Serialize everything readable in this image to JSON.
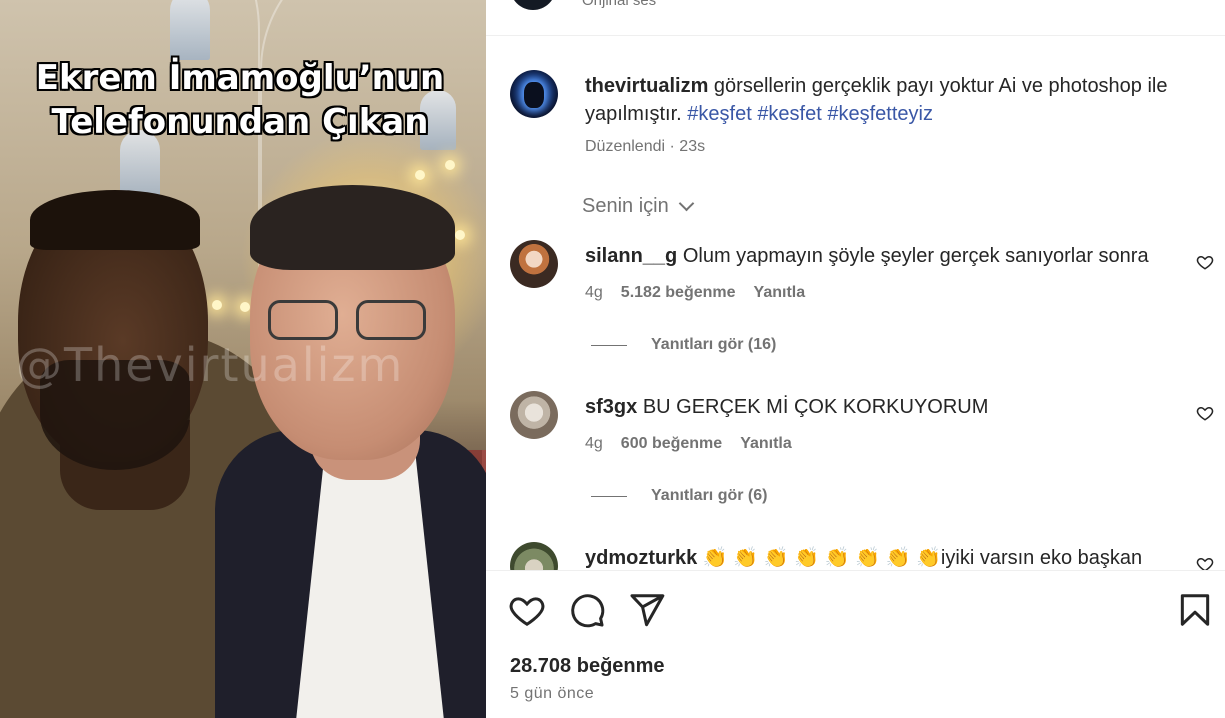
{
  "media": {
    "overlay_title_line1": "Ekrem İmamoğlu’nun",
    "overlay_title_line2": "Telefonundan Çıkan",
    "watermark": "@Thevirtualizm"
  },
  "header": {
    "audio_label": "Orijinal ses"
  },
  "caption": {
    "username": "thevirtualizm",
    "text": "görsellerin gerçeklik payı yoktur Ai ve photoshop ile yapılmıştır.",
    "hashtags": [
      "#keşfet",
      "#kesfet",
      "#keşfetteyiz"
    ],
    "edited_label": "Düzenlendi",
    "separator": "·",
    "age": "23s"
  },
  "sort": {
    "label": "Senin için"
  },
  "comments": [
    {
      "username": "silann__g",
      "text": "Olum yapmayın şöyle şeyler gerçek sanıyorlar sonra",
      "age": "4g",
      "likes": "5.182 beğenme",
      "reply_label": "Yanıtla",
      "view_replies": "Yanıtları gör (16)"
    },
    {
      "username": "sf3gx",
      "text": "BU GERÇEK Mİ ÇOK KORKUYORUM",
      "age": "4g",
      "likes": "600 beğenme",
      "reply_label": "Yanıtla",
      "view_replies": "Yanıtları gör (6)"
    },
    {
      "username": "ydmozturkk",
      "text": "👏 👏 👏 👏 👏 👏 👏 👏iyiki varsın eko başkan"
    }
  ],
  "footer": {
    "likes": "28.708 beğenme",
    "posted": "5 gün önce"
  },
  "icons": {
    "like": "heart-icon",
    "comment": "comment-icon",
    "share": "share-icon",
    "save": "bookmark-icon"
  },
  "colors": {
    "hashtag": "#3a57a6",
    "muted_text": "#737373",
    "primary_text": "#262626"
  }
}
